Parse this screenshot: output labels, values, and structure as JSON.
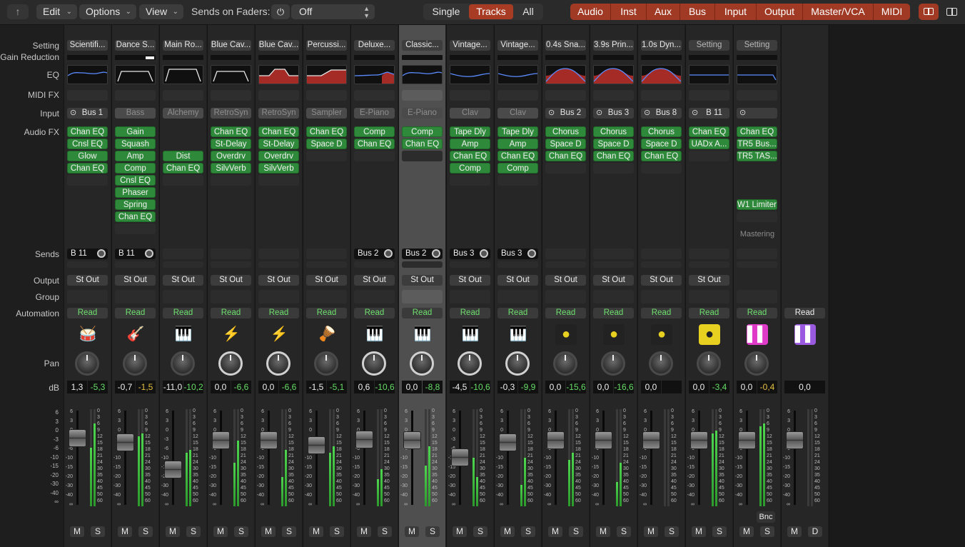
{
  "toolbar": {
    "back_arrow": "↑",
    "edit": "Edit",
    "options": "Options",
    "view": "View",
    "sends_on_faders_label": "Sends on Faders:",
    "sends_on_faders_value": "Off",
    "view_modes": [
      "Single",
      "Tracks",
      "All"
    ],
    "active_view_mode": "Tracks",
    "filters": [
      "Audio",
      "Inst",
      "Aux",
      "Bus",
      "Input",
      "Output",
      "Master/VCA",
      "MIDI"
    ],
    "accent_color": "#a83b24"
  },
  "row_labels": {
    "setting": "Setting",
    "gain_reduction": "Gain Reduction",
    "eq": "EQ",
    "midi_fx": "MIDI FX",
    "input": "Input",
    "audio_fx": "Audio FX",
    "sends": "Sends",
    "output": "Output",
    "group": "Group",
    "automation": "Automation",
    "pan": "Pan",
    "db": "dB"
  },
  "fader_scale": [
    "6",
    "3",
    "0",
    "-3",
    "-6",
    "-10",
    "-15",
    "-20",
    "-30",
    "-40",
    "∞"
  ],
  "meter_scale": [
    "0",
    "3",
    "6",
    "9",
    "12",
    "15",
    "18",
    "21",
    "24",
    "30",
    "35",
    "40",
    "45",
    "50",
    "60"
  ],
  "strips": [
    {
      "setting": "Scientifi...",
      "gr": false,
      "eq": "blue",
      "input": "Bus 1",
      "input_link": true,
      "fx": [
        "Chan EQ",
        "Cnsl EQ",
        "Glow",
        "Chan EQ"
      ],
      "send": "B 11",
      "output": "St Out",
      "auto": "Read",
      "icon": "drum-kit",
      "vol": "1,3",
      "peak": "-5,3",
      "peak_color": "g",
      "fader": 0.24,
      "meter_l": 0.6,
      "meter_r": 0.85,
      "m": "M",
      "s": "S"
    },
    {
      "setting": "Dance S...",
      "gr": true,
      "eq": "hp",
      "input": "Bass",
      "input_inst": true,
      "fx": [
        "Gain",
        "Squash",
        "Amp",
        "Comp",
        "Cnsl EQ",
        "Phaser",
        "Spring",
        "Chan EQ"
      ],
      "send": "B 11",
      "output": "St Out",
      "auto": "Read",
      "icon": "guitar",
      "vol": "-0,7",
      "peak": "-1,5",
      "peak_color": "y",
      "fader": 0.29,
      "meter_l": 0.72,
      "meter_r": 0.75,
      "m": "M",
      "s": "S"
    },
    {
      "setting": "Main Ro...",
      "gr": false,
      "eq": "flat",
      "input": "Alchemy",
      "input_inst": true,
      "fx": [
        "",
        "",
        "Dist",
        "Chan EQ"
      ],
      "send": "",
      "output": "St Out",
      "auto": "Read",
      "icon": "keyboard",
      "vol": "-11,0",
      "peak": "-10,2",
      "peak_color": "g",
      "fader": 0.64,
      "meter_l": 0.55,
      "meter_r": 0.58,
      "m": "M",
      "s": "S"
    },
    {
      "setting": "Blue Cav...",
      "gr": false,
      "eq": "hp",
      "input": "RetroSyn",
      "input_inst": true,
      "fx": [
        "Chan EQ",
        "St-Delay",
        "Overdrv",
        "SilvVerb"
      ],
      "send": "",
      "output": "St Out",
      "auto": "Read",
      "icon": "synth",
      "vol": "0,0",
      "peak": "-6,6",
      "peak_color": "g",
      "fader": 0.26,
      "meter_l": 0.45,
      "meter_r": 0.68,
      "m": "M",
      "s": "S"
    },
    {
      "setting": "Blue Cav...",
      "gr": false,
      "eq": "red",
      "input": "RetroSyn",
      "input_inst": true,
      "fx": [
        "Chan EQ",
        "St-Delay",
        "Overdrv",
        "SilvVerb"
      ],
      "send": "",
      "output": "St Out",
      "auto": "Read",
      "icon": "synth",
      "vol": "0,0",
      "peak": "-6,6",
      "peak_color": "g",
      "fader": 0.26,
      "meter_l": 0.3,
      "meter_r": 0.58,
      "m": "M",
      "s": "S"
    },
    {
      "setting": "Percussi...",
      "gr": false,
      "eq": "red2",
      "input": "Sampler",
      "input_inst": true,
      "fx": [
        "Chan EQ",
        "Space D"
      ],
      "send": "",
      "output": "St Out",
      "auto": "Read",
      "icon": "percussion",
      "vol": "-1,5",
      "peak": "-5,1",
      "peak_color": "g",
      "fader": 0.33,
      "meter_l": 0.55,
      "meter_r": 0.62,
      "m": "M",
      "s": "S"
    },
    {
      "setting": "Deluxe...",
      "gr": false,
      "eq": "blue-red",
      "input": "E-Piano",
      "input_inst": true,
      "fx": [
        "Comp",
        "Chan EQ"
      ],
      "send": "Bus 2",
      "output": "St Out",
      "auto": "Read",
      "icon": "e-piano",
      "vol": "0,6",
      "peak": "-10,6",
      "peak_color": "g",
      "fader": 0.25,
      "meter_l": 0.28,
      "meter_r": 0.38,
      "m": "M",
      "s": "S"
    },
    {
      "setting": "Classic...",
      "gr": false,
      "eq": "blue",
      "input": "E-Piano",
      "input_inst": true,
      "fx": [
        "Comp",
        "Chan EQ"
      ],
      "send": "Bus 2",
      "output": "St Out",
      "auto": "Read",
      "icon": "e-piano",
      "vol": "0,0",
      "peak": "-8,8",
      "peak_color": "g",
      "fader": 0.26,
      "meter_l": 0.42,
      "meter_r": 0.62,
      "m": "M",
      "s": "S",
      "selected": true
    },
    {
      "setting": "Vintage...",
      "gr": false,
      "eq": "blue-dip",
      "input": "Clav",
      "input_inst": true,
      "fx": [
        "Tape Dly",
        "Amp",
        "Chan EQ",
        "Comp"
      ],
      "send": "Bus 3",
      "output": "St Out",
      "auto": "Read",
      "icon": "clav",
      "vol": "-4,5",
      "peak": "-10,6",
      "peak_color": "g",
      "fader": 0.48,
      "meter_l": 0.5,
      "meter_r": 0.3,
      "m": "M",
      "s": "S"
    },
    {
      "setting": "Vintage...",
      "gr": false,
      "eq": "blue-dip",
      "input": "Clav",
      "input_inst": true,
      "fx": [
        "Tape Dly",
        "Amp",
        "Chan EQ",
        "Comp"
      ],
      "send": "Bus 3",
      "output": "St Out",
      "auto": "Read",
      "icon": "clav",
      "vol": "-0,3",
      "peak": "-9,9",
      "peak_color": "g",
      "fader": 0.29,
      "meter_l": 0.22,
      "meter_r": 0.5,
      "m": "M",
      "s": "S"
    },
    {
      "setting": "0.4s Sna...",
      "gr": false,
      "eq": "bump-red",
      "input": "Bus 2",
      "input_link": true,
      "fx": [
        "Chorus",
        "Space D",
        "Chan EQ"
      ],
      "send": "",
      "output": "St Out",
      "auto": "Read",
      "icon": "aux-knob",
      "vol": "0,0",
      "peak": "-15,6",
      "peak_color": "g",
      "fader": 0.26,
      "meter_l": 0.48,
      "meter_r": 0.55,
      "m": "M",
      "s": "S"
    },
    {
      "setting": "3.9s Prin...",
      "gr": false,
      "eq": "bump-red",
      "input": "Bus 3",
      "input_link": true,
      "fx": [
        "Chorus",
        "Space D",
        "Chan EQ"
      ],
      "send": "",
      "output": "St Out",
      "auto": "Read",
      "icon": "aux-knob",
      "vol": "0,0",
      "peak": "-16,6",
      "peak_color": "g",
      "fader": 0.26,
      "meter_l": 0.25,
      "meter_r": 0.45,
      "m": "M",
      "s": "S"
    },
    {
      "setting": "1.0s Dyn...",
      "gr": false,
      "eq": "bump-red",
      "input": "Bus 8",
      "input_link": true,
      "fx": [
        "Chorus",
        "Space D",
        "Chan EQ"
      ],
      "send": "",
      "output": "St Out",
      "auto": "Read",
      "icon": "aux-knob",
      "vol": "0,0",
      "peak": "",
      "peak_color": "n",
      "fader": 0.26,
      "meter_l": 0.0,
      "meter_r": 0.0,
      "m": "M",
      "s": "S"
    },
    {
      "setting": "Setting",
      "gr": false,
      "eq": "flat-blue",
      "input": "B 11",
      "input_link": true,
      "fx": [
        "Chan EQ",
        "UADx A..."
      ],
      "send": "",
      "output": "St Out",
      "auto": "Read",
      "icon": "aux-knob-bright",
      "vol": "0,0",
      "peak": "-3,4",
      "peak_color": "g",
      "fader": 0.26,
      "meter_l": 0.75,
      "meter_r": 0.78,
      "m": "M",
      "s": "S",
      "setting_dim": true
    },
    {
      "setting": "Setting",
      "gr": false,
      "eq": "flat-blue-hp",
      "input": "",
      "input_link": true,
      "fx": [
        "Chan EQ",
        "TR5 Bus...",
        "TR5 TAS...",
        "",
        "",
        "",
        "W1 Limiter"
      ],
      "send": "",
      "output": "",
      "auto": "Read",
      "icon": "master-wave",
      "vol": "0,0",
      "peak": "-0,4",
      "peak_color": "y",
      "fader": 0.26,
      "meter_l": 0.82,
      "meter_r": 0.85,
      "m": "M",
      "s": "S",
      "mastering": "Mastering",
      "bnc": "Bnc",
      "setting_dim": true
    },
    {
      "setting": "",
      "gr": false,
      "eq": "",
      "input": "",
      "fx": [],
      "send": "",
      "output": "",
      "auto": "Read",
      "auto_white": true,
      "icon": "vca-wave",
      "vol": "0,0",
      "peak": "",
      "peak_color": "n",
      "fader": 0.26,
      "meter_l": 0,
      "meter_r": 0,
      "m": "M",
      "s": "D",
      "empty": true
    }
  ]
}
